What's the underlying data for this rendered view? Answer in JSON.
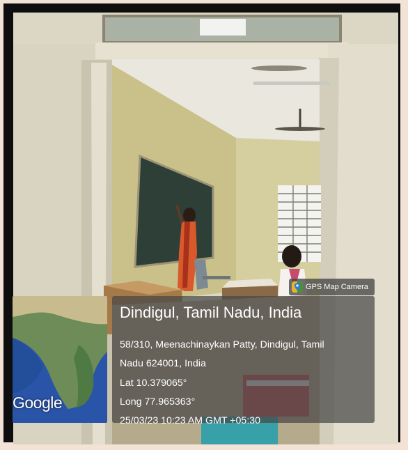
{
  "badge": {
    "label": "GPS Map Camera",
    "icon": "map-pin-icon"
  },
  "location": {
    "place": "Dindigul, Tamil Nadu, India",
    "address_line1": "58/310, Meenachinaykan Patty, Dindigul, Tamil",
    "address_line2": "Nadu 624001, India",
    "lat": "Lat 10.379065°",
    "long": "Long 77.965363°",
    "timestamp": "25/03/23 10:23 AM GMT +05:30"
  },
  "map": {
    "provider_logo": "Google"
  }
}
